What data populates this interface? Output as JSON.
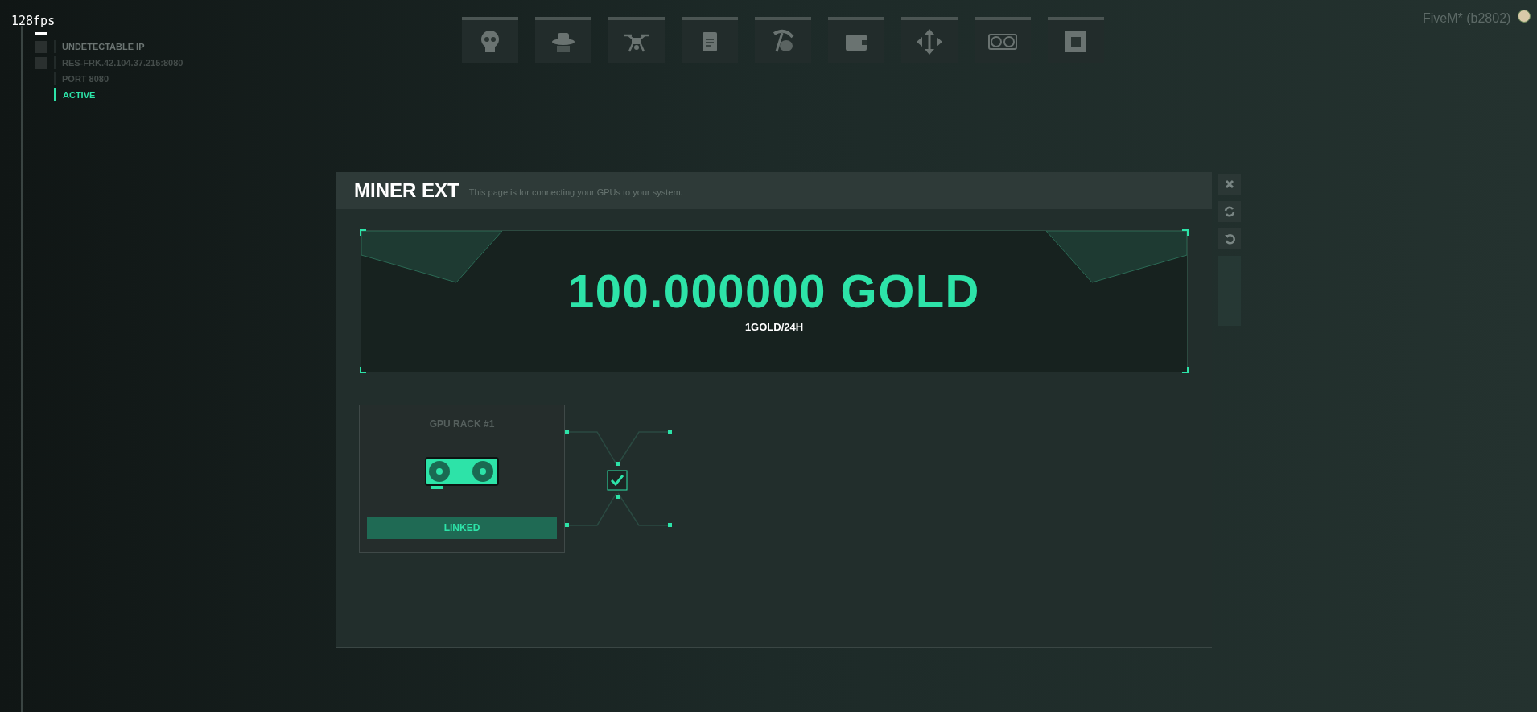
{
  "overlay": {
    "fps": "128fps",
    "network": [
      {
        "label": "UNDETECTABLE IP",
        "active": false
      },
      {
        "label": "RES-FRK.42.104.37.215:8080",
        "active": false
      },
      {
        "label": "PORT 8080",
        "active": false
      },
      {
        "label": "ACTIVE",
        "active": true
      }
    ],
    "build": "FiveM* (b2802)"
  },
  "window": {
    "title": "MINER EXT",
    "subtitle": "This page is for connecting your GPUs to your system."
  },
  "balance": {
    "amount": "100.000000 GOLD",
    "rate": "1GOLD/24H"
  },
  "racks": [
    {
      "title": "GPU RACK #1",
      "status": "LINKED",
      "linked": true
    }
  ]
}
